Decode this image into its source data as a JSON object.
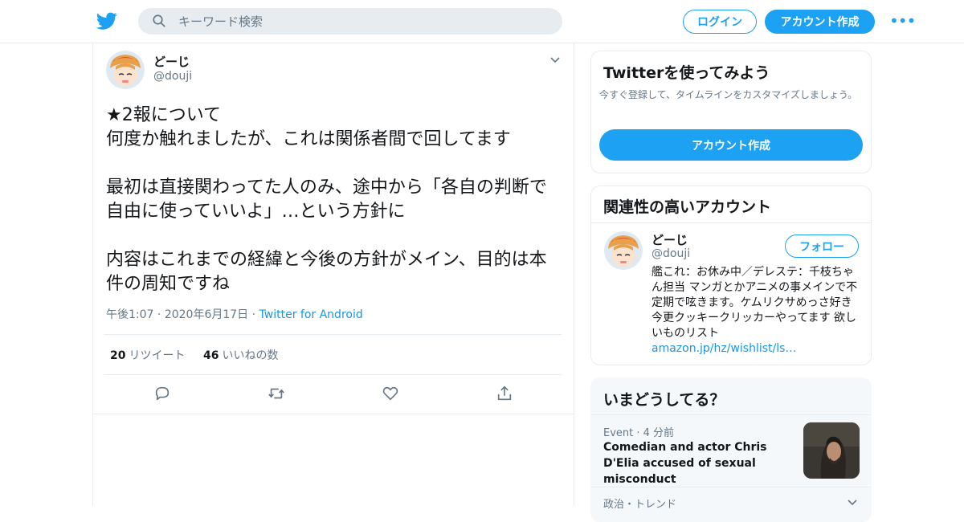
{
  "header": {
    "search_placeholder": "キーワード検索",
    "login_label": "ログイン",
    "signup_label": "アカウント作成",
    "more_label": "•••"
  },
  "tweet": {
    "author_name": "どーじ",
    "author_handle": "@douji",
    "text": "★2報について\n何度か触れましたが、これは関係者間で回してます\n\n最初は直接関わってた人のみ、途中から「各自の判断で自由に使っていいよ」…という方針に\n\n内容はこれまでの経緯と今後の方針がメイン、目的は本件の周知ですね",
    "time": "午後1:07",
    "date": "2020年6月17日",
    "source": "Twitter for Android",
    "retweet_count": "20",
    "retweet_label": "リツイート",
    "like_count": "46",
    "like_label": "いいねの数"
  },
  "signup_card": {
    "title": "Twitterを使ってみよう",
    "description": "今すぐ登録して、タイムラインをカスタマイズしましょう。",
    "button_label": "アカウント作成"
  },
  "related_card": {
    "title": "関連性の高いアカウント",
    "name": "どーじ",
    "handle": "@douji",
    "follow_label": "フォロー",
    "bio": "艦これ：お休み中／デレステ：千枝ちゃん担当 マンガとかアニメの事メインで不定期で呟きます。ケムリクサめっさ好き 今更クッキークリッカーやってます 欲しいものリスト ",
    "bio_link": "amazon.jp/hz/wishlist/ls…"
  },
  "trends_card": {
    "title": "いまどうしてる？",
    "item1_category": "Event",
    "item1_time": "4 分前",
    "item1_title": "Comedian and actor Chris D'Elia accused of sexual misconduct",
    "item2_category": "政治・トレンド"
  },
  "colors": {
    "accent": "#1da1f2",
    "link": "#1b95e0",
    "secondary_text": "#657786",
    "border": "#e6ecf0"
  }
}
